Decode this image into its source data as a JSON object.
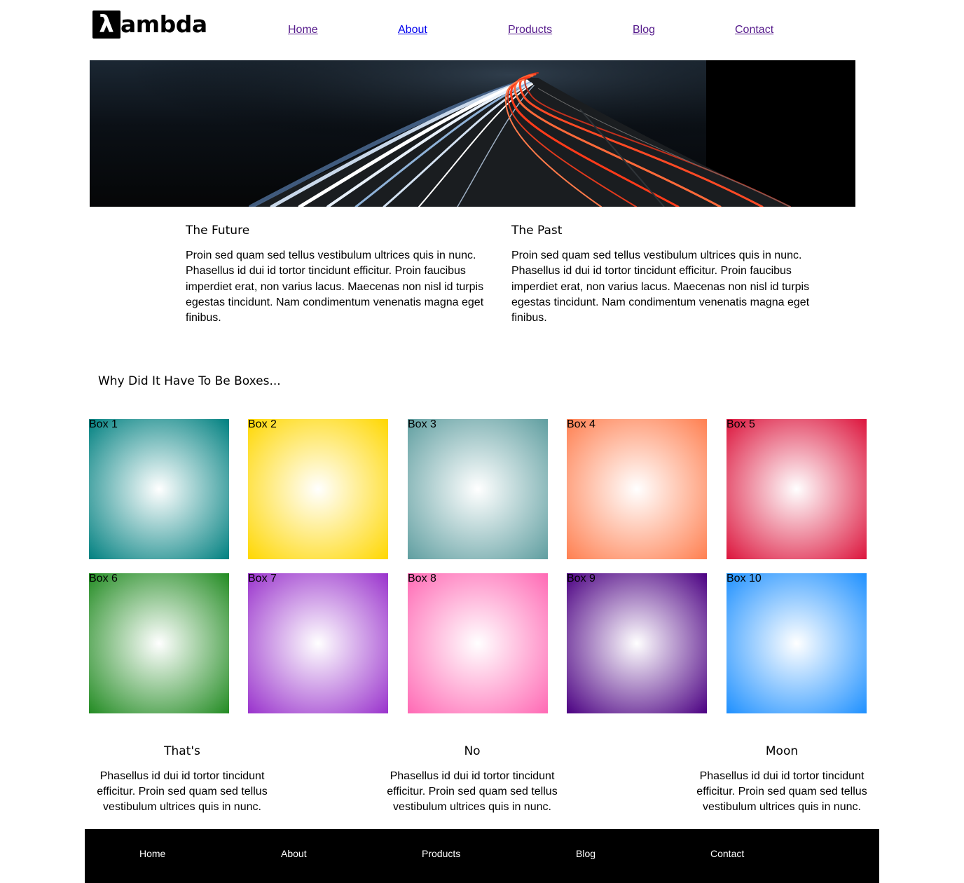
{
  "header": {
    "logo_mark": "λ",
    "logo_text": "ambda",
    "nav": [
      "Home",
      "About",
      "Products",
      "Blog",
      "Contact"
    ]
  },
  "hero": {
    "icon": "road-light-trails-image"
  },
  "columns": [
    {
      "title": "The Future",
      "text": "Proin sed quam sed tellus vestibulum ultrices quis in nunc. Phasellus id dui id tortor tincidunt efficitur. Proin faucibus imperdiet erat, non varius lacus. Maecenas non nisl id turpis egestas tincidunt. Nam condimentum venenatis magna eget finibus."
    },
    {
      "title": "The Past",
      "text": "Proin sed quam sed tellus vestibulum ultrices quis in nunc. Phasellus id dui id tortor tincidunt efficitur. Proin faucibus imperdiet erat, non varius lacus. Maecenas non nisl id turpis egestas tincidunt. Nam condimentum venenatis magna eget finibus."
    }
  ],
  "boxes_heading": "Why Did It Have To Be Boxes...",
  "boxes": [
    {
      "label": "Box 1",
      "color": "#008080"
    },
    {
      "label": "Box 2",
      "color": "#ffd700"
    },
    {
      "label": "Box 3",
      "color": "#5f9ea0"
    },
    {
      "label": "Box 4",
      "color": "#ff7f50"
    },
    {
      "label": "Box 5",
      "color": "#dc143c"
    },
    {
      "label": "Box 6",
      "color": "#228b22"
    },
    {
      "label": "Box 7",
      "color": "#9932cc"
    },
    {
      "label": "Box 8",
      "color": "#ff69b4"
    },
    {
      "label": "Box 9",
      "color": "#4b0082"
    },
    {
      "label": "Box 10",
      "color": "#1e90ff"
    }
  ],
  "trio": [
    {
      "title": "That's",
      "text": "Phasellus id dui id tortor tincidunt efficitur. Proin sed quam sed tellus vestibulum ultrices quis in nunc."
    },
    {
      "title": "No",
      "text": "Phasellus id dui id tortor tincidunt efficitur. Proin sed quam sed tellus vestibulum ultrices quis in nunc."
    },
    {
      "title": "Moon",
      "text": "Phasellus id dui id tortor tincidunt efficitur. Proin sed quam sed tellus vestibulum ultrices quis in nunc."
    }
  ],
  "footer": {
    "nav": [
      "Home",
      "About",
      "Products",
      "Blog",
      "Contact"
    ]
  }
}
